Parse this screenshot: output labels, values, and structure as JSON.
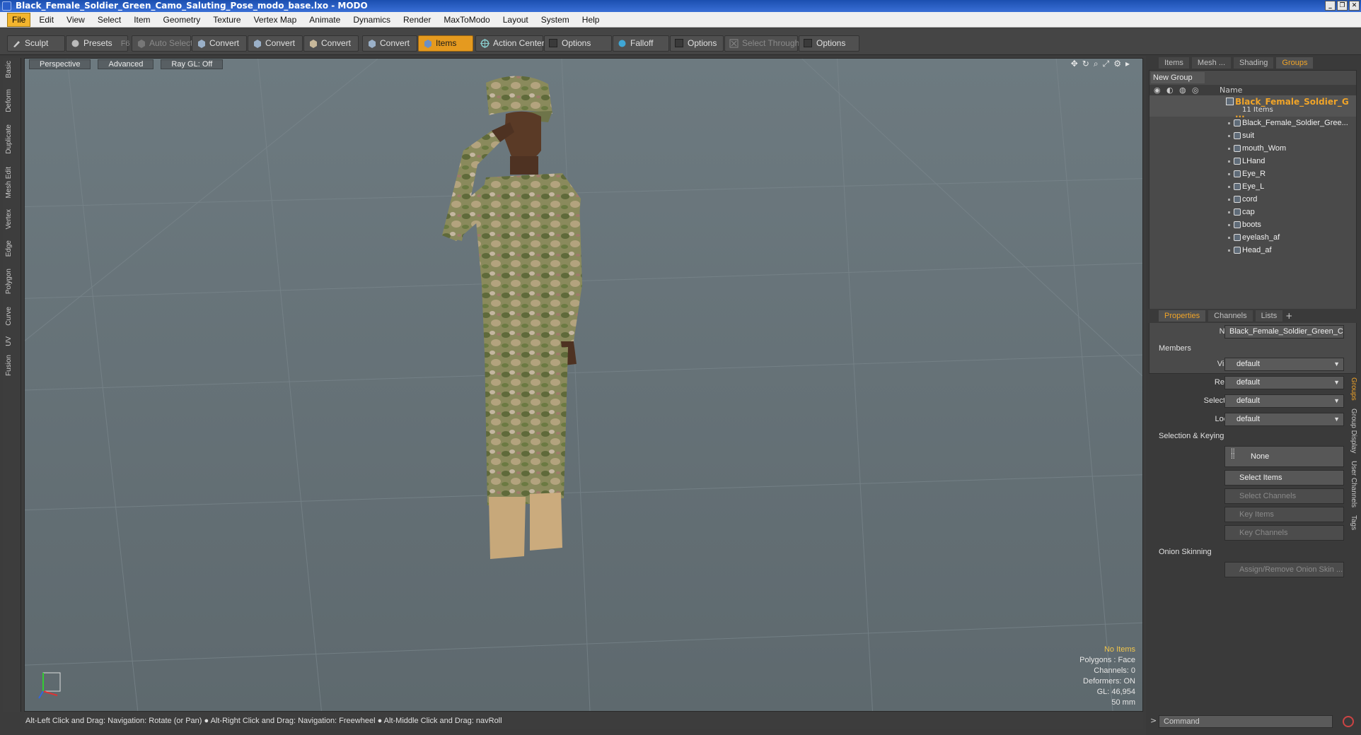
{
  "window": {
    "title": "Black_Female_Soldier_Green_Camo_Saluting_Pose_modo_base.lxo - MODO"
  },
  "menubar": [
    "File",
    "Edit",
    "View",
    "Select",
    "Item",
    "Geometry",
    "Texture",
    "Vertex Map",
    "Animate",
    "Dynamics",
    "Render",
    "MaxToModo",
    "Layout",
    "System",
    "Help"
  ],
  "toolbar": {
    "sculpt": "Sculpt",
    "presets": "Presets",
    "presets_key": "F6",
    "auto_select": "Auto Select",
    "convert1": "Convert",
    "convert2": "Convert",
    "convert3": "Convert",
    "convert4": "Convert",
    "items": "Items",
    "action_center": "Action Center",
    "options1": "Options",
    "falloff": "Falloff",
    "options2": "Options",
    "select_through": "Select Through",
    "options3": "Options"
  },
  "left_tabs": [
    "Basic",
    "Deform",
    "Duplicate",
    "Mesh Edit",
    "Vertex",
    "Edge",
    "Polygon",
    "Curve",
    "UV",
    "Fusion"
  ],
  "viewport": {
    "view": "Perspective",
    "shading": "Advanced",
    "raygl": "Ray GL: Off",
    "info": {
      "selection": "No Items",
      "polygons": "Polygons : Face",
      "channels": "Channels: 0",
      "deformers": "Deformers: ON",
      "gl": "GL: 46,954",
      "scale": "50 mm"
    }
  },
  "statusbar": "Alt-Left Click and Drag: Navigation: Rotate (or Pan) ● Alt-Right Click and Drag: Navigation: Freewheel ● Alt-Middle Click and Drag: navRoll",
  "right_tabs": [
    "Items",
    "Mesh ...",
    "Shading",
    "Groups"
  ],
  "groups": {
    "new_group": "New Group",
    "name_col": "Name",
    "parent": "Black_Female_Soldier_G ...",
    "parent_sub": "11 Items",
    "children": [
      "Black_Female_Soldier_Gree...",
      "suit",
      "mouth_Wom",
      "LHand",
      "Eye_R",
      "Eye_L",
      "cord",
      "cap",
      "boots",
      "eyelash_af",
      "Head_af"
    ]
  },
  "prop_tabs": [
    "Properties",
    "Channels",
    "Lists"
  ],
  "properties": {
    "name_label": "Name",
    "name_value": "Black_Female_Soldier_Green_Ca",
    "members": "Members",
    "visible_label": "Visible",
    "render_label": "Render",
    "selectable_label": "Selectable",
    "locked_label": "Locked",
    "default": "default",
    "selection_keying": "Selection & Keying",
    "none": "None",
    "select_items": "Select Items",
    "select_channels": "Select Channels",
    "key_items": "Key Items",
    "key_channels": "Key Channels",
    "onion": "Onion Skinning",
    "assign_onion": "Assign/Remove Onion Skin ..."
  },
  "right_vtabs": [
    "Groups",
    "Group Display",
    "User Channels",
    "Tags"
  ],
  "command": {
    "placeholder": "Command",
    "prompt": ">"
  }
}
